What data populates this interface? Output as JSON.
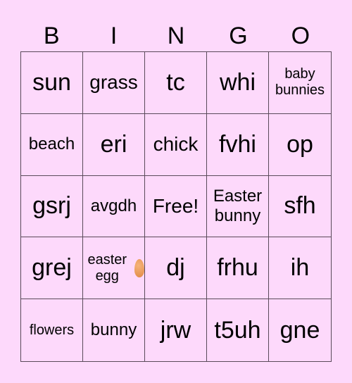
{
  "header": [
    "B",
    "I",
    "N",
    "G",
    "O"
  ],
  "cells": [
    {
      "text": "sun",
      "size": "xl"
    },
    {
      "text": "grass",
      "size": "l"
    },
    {
      "text": "tc",
      "size": "xl"
    },
    {
      "text": "whi",
      "size": "xl"
    },
    {
      "text": "baby bunnies",
      "size": "s"
    },
    {
      "text": "beach",
      "size": "m"
    },
    {
      "text": "eri",
      "size": "xl"
    },
    {
      "text": "chick",
      "size": "l"
    },
    {
      "text": "fvhi",
      "size": "xl"
    },
    {
      "text": "op",
      "size": "xl"
    },
    {
      "text": "gsrj",
      "size": "xl"
    },
    {
      "text": "avgdh",
      "size": "m"
    },
    {
      "text": "Free!",
      "size": "l"
    },
    {
      "text": "Easter bunny",
      "size": "m"
    },
    {
      "text": "sfh",
      "size": "xl"
    },
    {
      "text": "grej",
      "size": "xl"
    },
    {
      "text": "easter egg",
      "size": "s",
      "icon": "egg-icon"
    },
    {
      "text": "dj",
      "size": "xl"
    },
    {
      "text": "frhu",
      "size": "xl"
    },
    {
      "text": "ih",
      "size": "xl"
    },
    {
      "text": "flowers",
      "size": "s"
    },
    {
      "text": "bunny",
      "size": "m"
    },
    {
      "text": "jrw",
      "size": "xl"
    },
    {
      "text": "t5uh",
      "size": "xl"
    },
    {
      "text": "gne",
      "size": "xl"
    }
  ],
  "colors": {
    "background": "#fdd9fb",
    "grid_line": "#5a4a5a"
  }
}
